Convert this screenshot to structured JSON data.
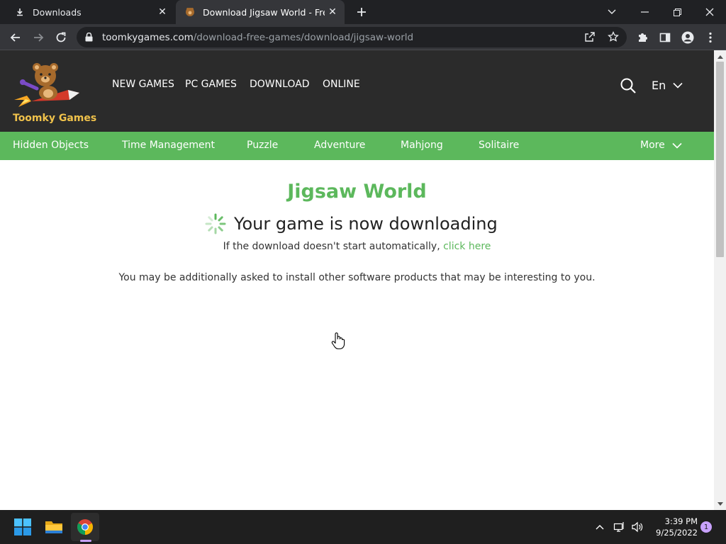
{
  "browser": {
    "tabs": [
      {
        "title": "Downloads",
        "icon": "download-icon",
        "active": false
      },
      {
        "title": "Download Jigsaw World - Free PC",
        "icon": "toomky-favicon",
        "active": true
      }
    ],
    "url_host": "toomkygames.com",
    "url_path": "/download-free-games/download/jigsaw-world"
  },
  "site": {
    "brand": "Toomky Games",
    "nav": [
      "NEW GAMES",
      "PC GAMES",
      "DOWNLOAD",
      "ONLINE"
    ],
    "language": "En",
    "categories": [
      "Hidden Objects",
      "Time Management",
      "Puzzle",
      "Adventure",
      "Mahjong",
      "Solitaire"
    ],
    "more_label": "More",
    "accent_color": "#5cb85c",
    "header_color": "#2b2b2b"
  },
  "content": {
    "title": "Jigsaw World",
    "downloading": "Your game is now downloading",
    "fallback_prefix": "If the download doesn't start automatically,",
    "fallback_link": "click here",
    "extra_note": "You may be additionally asked to install other software products that may be interesting to you."
  },
  "taskbar": {
    "time": "3:39 PM",
    "date": "9/25/2022",
    "notifications": "1"
  }
}
